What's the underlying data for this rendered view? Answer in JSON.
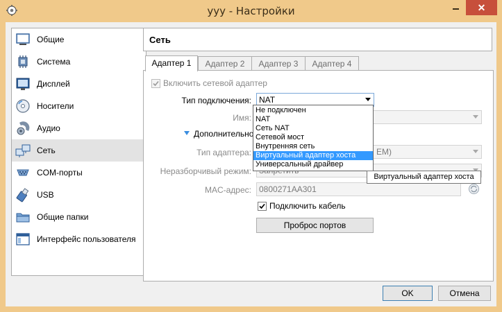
{
  "window": {
    "title": "yyy - Настройки",
    "close_glyph": "✕"
  },
  "sidebar": {
    "items": [
      {
        "label": "Общие",
        "icon": "general-icon"
      },
      {
        "label": "Система",
        "icon": "system-icon"
      },
      {
        "label": "Дисплей",
        "icon": "display-icon"
      },
      {
        "label": "Носители",
        "icon": "storage-icon"
      },
      {
        "label": "Аудио",
        "icon": "audio-icon"
      },
      {
        "label": "Сеть",
        "icon": "network-icon",
        "active": true
      },
      {
        "label": "COM-порты",
        "icon": "serial-ports-icon"
      },
      {
        "label": "USB",
        "icon": "usb-icon"
      },
      {
        "label": "Общие папки",
        "icon": "shared-folders-icon"
      },
      {
        "label": "Интерфейс пользователя",
        "icon": "user-interface-icon"
      }
    ]
  },
  "section": {
    "title": "Сеть"
  },
  "tabs": [
    {
      "label": "Адаптер 1",
      "active": true
    },
    {
      "label": "Адаптер 2"
    },
    {
      "label": "Адаптер 3"
    },
    {
      "label": "Адаптер 4"
    }
  ],
  "adapter": {
    "enable_label": "Включить сетевой адаптер",
    "enabled": true,
    "attached_label": "Тип подключения:",
    "attached_value": "NAT",
    "name_label": "Имя:",
    "advanced_label": "Дополнительно",
    "adapter_type_label": "Тип адаптера:",
    "adapter_type_value_visible": "EM)",
    "promisc_label": "Неразборчивый режим:",
    "promisc_value": "Запретить",
    "mac_label": "MAC-адрес:",
    "mac_value": "0800271AA301",
    "cable_label": "Подключить кабель",
    "cable_connected": true,
    "port_forwarding_label": "Проброс портов"
  },
  "dropdown": {
    "options": [
      "Не подключен",
      "NAT",
      "Сеть NAT",
      "Сетевой мост",
      "Внутренняя сеть",
      "Виртуальный адаптер хоста",
      "Универсальный драйвер"
    ],
    "highlighted_index": 5
  },
  "tooltip": {
    "text": "Виртуальный адаптер хоста"
  },
  "buttons": {
    "ok": "OK",
    "cancel": "Отмена"
  },
  "colors": {
    "title_bar": "#f0c98a",
    "close_button": "#c74f3b",
    "highlight": "#3399ff"
  }
}
